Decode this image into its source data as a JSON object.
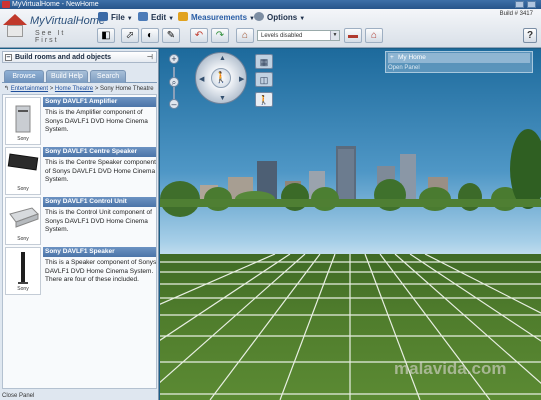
{
  "window": {
    "title": "MyVirtualHome - NewHome"
  },
  "toolbar": {
    "logo_name": "MyVirtualHome",
    "logo_tagline": "See It First",
    "menus": {
      "file": "File",
      "edit": "Edit",
      "measurements": "Measurements",
      "options": "Options"
    },
    "build_label": "Build # 3417",
    "levels_value": "Levels disabled",
    "help": "?"
  },
  "left_panel": {
    "header": "Build rooms and add objects",
    "tabs": [
      "Browse",
      "Build Help",
      "Search"
    ],
    "breadcrumb": {
      "link1": "Entertainment",
      "sep1": " > ",
      "link2": "Home Theatre",
      "sep2": " > ",
      "current": "Sony Home Theatre"
    },
    "items": [
      {
        "title": "Sony DAVLF1 Amplifier",
        "description": "This is the Amplifier component of Sonys DAVLF1 DVD Home Cinema System.",
        "brand": "Sony"
      },
      {
        "title": "Sony DAVLF1 Centre Speaker",
        "description": "This is the Centre Speaker component of Sonys DAVLF1 DVD Home Cinema System.",
        "brand": "Sony"
      },
      {
        "title": "Sony DAVLF1 Control Unit",
        "description": "This is the Control Unit component of Sonys DAVLF1 DVD Home Cinema System.",
        "brand": "Sony"
      },
      {
        "title": "Sony DAVLF1 Speaker",
        "description": "This is a Speaker component of Sonys DAVLF1 DVD Home Cinema System. There are four of these included.",
        "brand": "Sony"
      }
    ],
    "close_panel": "Close Panel"
  },
  "right_panel": {
    "title": "My Home",
    "subtitle": "Open Panel"
  },
  "watermark": "malavida.com",
  "colors": {
    "item_title_bg": "#5a82b5",
    "tab_bg": "#8aaed4",
    "sky_top": "#1d6a9c",
    "ground": "#4f7c2c"
  }
}
